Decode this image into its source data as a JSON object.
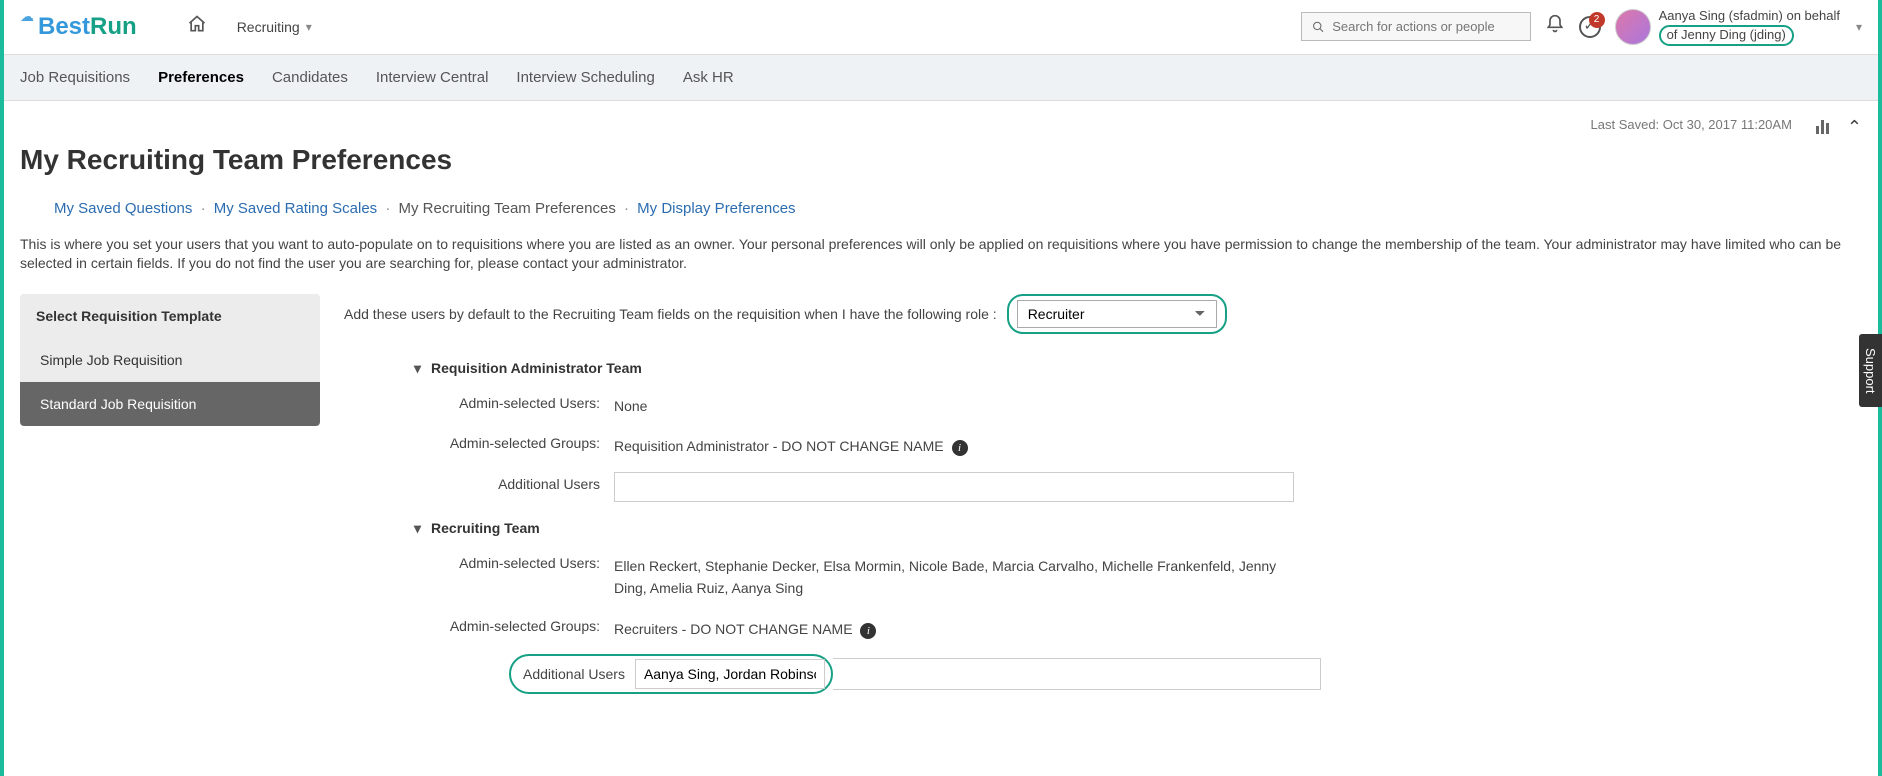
{
  "brand": {
    "best": "Best",
    "run": "Run"
  },
  "module": {
    "label": "Recruiting"
  },
  "search": {
    "placeholder": "Search for actions or people"
  },
  "todoBadge": "2",
  "user": {
    "line1": "Aanya Sing (sfadmin) on behalf",
    "line2": "of Jenny Ding (jding)"
  },
  "subnav": {
    "jobReq": "Job Requisitions",
    "prefs": "Preferences",
    "candidates": "Candidates",
    "interviewCentral": "Interview Central",
    "interviewScheduling": "Interview Scheduling",
    "askHr": "Ask HR"
  },
  "lastSaved": "Last Saved: Oct 30, 2017 11:20AM",
  "pageTitle": "My Recruiting Team Preferences",
  "crumbs": {
    "savedQuestions": "My Saved Questions",
    "savedScales": "My Saved Rating Scales",
    "teamPrefs": "My Recruiting Team Preferences",
    "displayPrefs": "My Display Preferences"
  },
  "helpText": "This is where you set your users that you want to auto-populate on to requisitions where you are listed as an owner. Your personal preferences will only be applied on requisitions where you have permission to change the membership of the team. Your administrator may have limited who can be selected in certain fields. If you do not find the user you are searching for, please contact your administrator.",
  "leftPanel": {
    "header": "Select Requisition Template",
    "item1": "Simple Job Requisition",
    "item2": "Standard Job Requisition"
  },
  "roleRow": {
    "label": "Add these users by default to the Recruiting Team fields on the requisition when I have the following role :",
    "selected": "Recruiter"
  },
  "labels": {
    "adminUsers": "Admin-selected Users:",
    "adminGroups": "Admin-selected Groups:",
    "additionalUsers": "Additional Users"
  },
  "section1": {
    "title": "Requisition Administrator Team",
    "adminUsers": "None",
    "adminGroups": "Requisition Administrator - DO NOT CHANGE NAME",
    "additionalUsersValue": ""
  },
  "section2": {
    "title": "Recruiting Team",
    "adminUsers": "Ellen Reckert, Stephanie Decker, Elsa Mormin, Nicole Bade, Marcia Carvalho, Michelle Frankenfeld, Jenny Ding, Amelia Ruiz, Aanya Sing",
    "adminGroups": "Recruiters - DO NOT CHANGE NAME",
    "additionalUsersValue": "Aanya Sing, Jordan Robinson,"
  },
  "supportTab": "Support"
}
